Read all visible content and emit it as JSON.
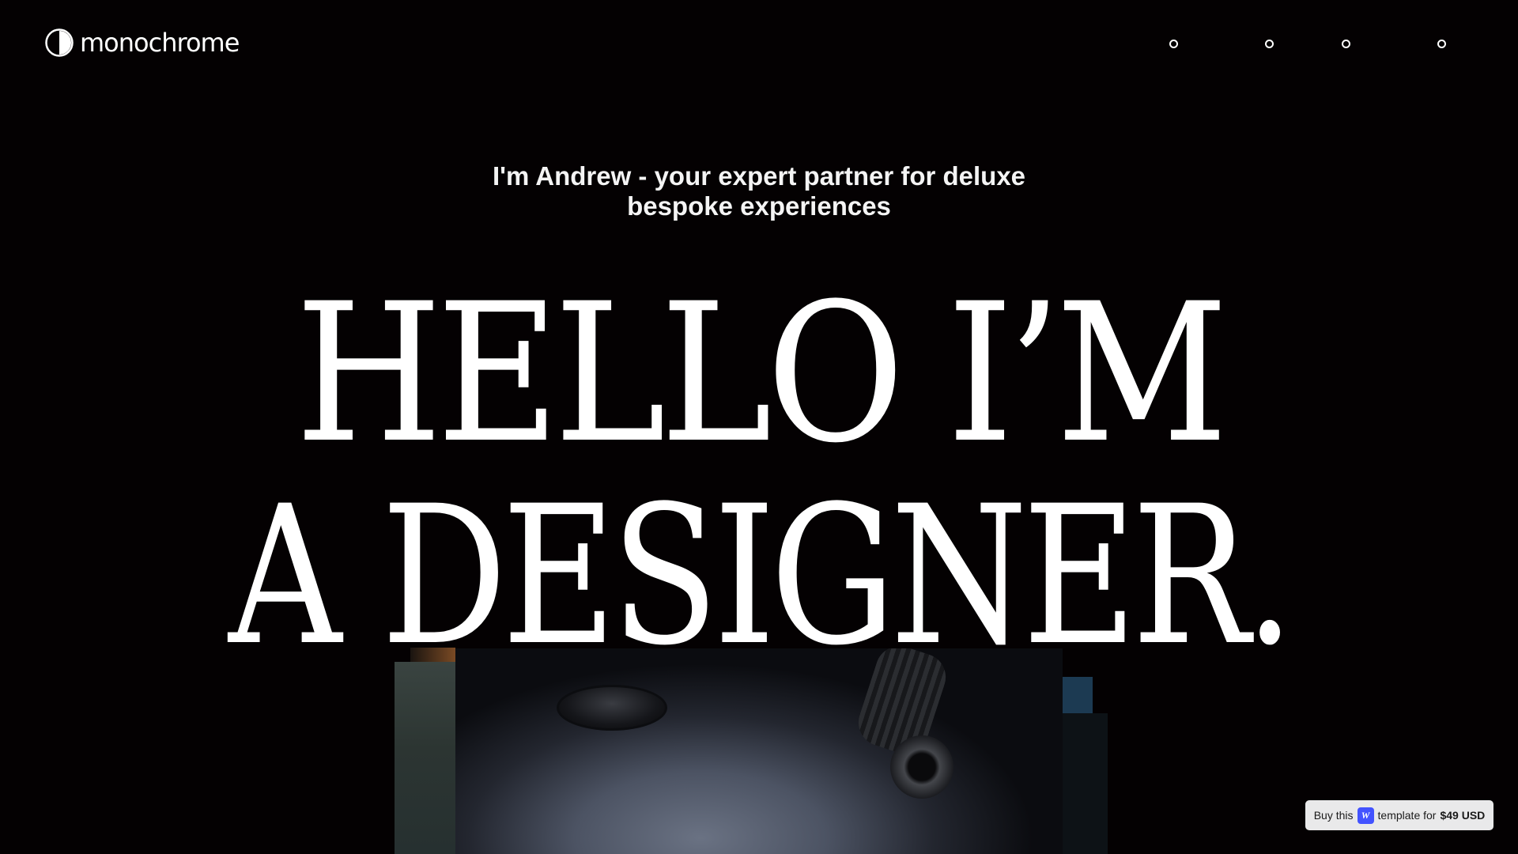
{
  "header": {
    "brand_name": "monochrome",
    "nav_dots": [
      "nav-dot-1",
      "nav-dot-2",
      "nav-dot-3",
      "nav-dot-4"
    ]
  },
  "hero": {
    "tagline_line_1": "I'm Andrew - your expert partner for deluxe",
    "tagline_line_2": "bespoke experiences",
    "title_line_1": "HELLO I’M",
    "title_line_2": "A DESIGNER."
  },
  "buy_badge": {
    "prefix": "Buy this",
    "platform_icon_letter": "W",
    "middle": "template for",
    "price": "$49 USD"
  },
  "colors": {
    "background": "#040102",
    "text": "#ffffff",
    "badge_background": "#e9e9ea",
    "platform_blue": "#4353ff"
  }
}
